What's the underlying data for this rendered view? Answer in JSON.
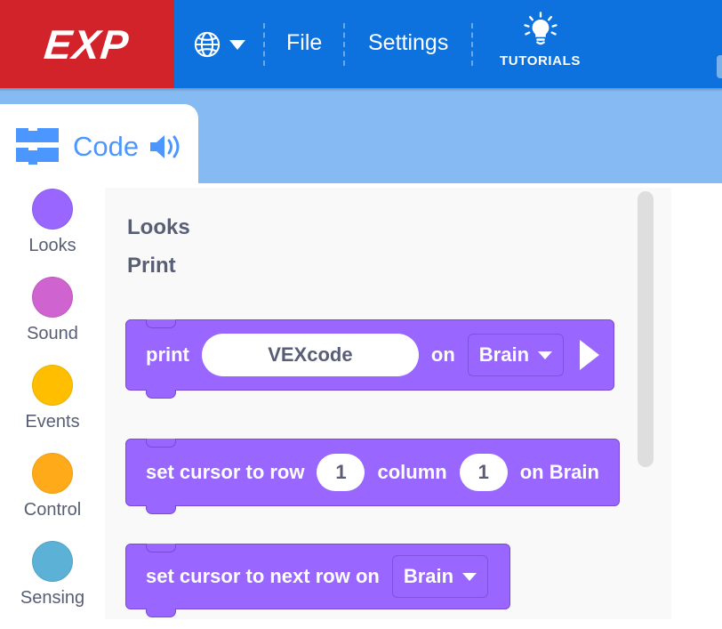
{
  "app": {
    "brand": "EXP",
    "header_blue": "#0E72DE",
    "brand_red": "#D2232A",
    "band_blue": "#85BBF2"
  },
  "header": {
    "logo_label": "EXP",
    "globe_icon": "globe-icon",
    "globe_caret_icon": "chevron-down-icon",
    "menus": [
      {
        "label": "File",
        "name": "file"
      },
      {
        "label": "Settings",
        "name": "settings"
      }
    ],
    "tutorials": {
      "label": "TUTORIALS",
      "icon": "lightbulb-icon"
    }
  },
  "code_tab": {
    "label": "Code",
    "blocks_icon": "blocks-icon",
    "speaker_icon": "speaker-icon",
    "accent": "#4C97FF"
  },
  "sidebar": {
    "items": [
      {
        "label": "Looks",
        "color": "#9966FF",
        "name": "looks"
      },
      {
        "label": "Sound",
        "color": "#CF63CF",
        "name": "sound"
      },
      {
        "label": "Events",
        "color": "#FFBF00",
        "name": "events"
      },
      {
        "label": "Control",
        "color": "#FFAB19",
        "name": "control"
      },
      {
        "label": "Sensing",
        "color": "#5CB1D6",
        "name": "sensing"
      }
    ]
  },
  "flyout": {
    "category_heading": "Looks",
    "section_heading": "Print",
    "block_color": "#9966FF",
    "blocks": {
      "print": {
        "label_1": "print",
        "value": "VEXcode",
        "label_2": "on",
        "dropdown": "Brain",
        "play_icon": "play-icon"
      },
      "set_cursor": {
        "label_1": "set cursor to row",
        "row": "1",
        "label_2": "column",
        "column": "1",
        "label_3": "on Brain"
      },
      "next_row": {
        "label_1": "set cursor to next row on",
        "dropdown": "Brain"
      }
    }
  }
}
